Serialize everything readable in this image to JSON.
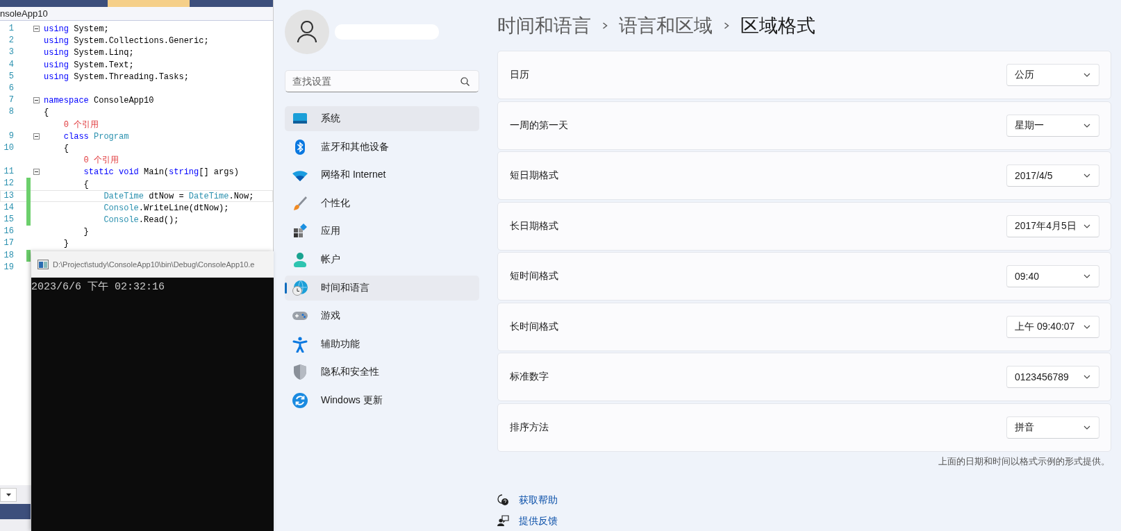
{
  "editor": {
    "title": "nsoleApp10",
    "lines": [
      {
        "kind": "code",
        "number": "1",
        "fold": true,
        "changed": false,
        "current": false,
        "tokens": [
          {
            "kind": "keyword",
            "text": "using"
          },
          {
            "kind": "plain",
            "text": " System;"
          }
        ]
      },
      {
        "kind": "code",
        "number": "2",
        "fold": false,
        "changed": false,
        "current": false,
        "tokens": [
          {
            "kind": "keyword",
            "text": "using"
          },
          {
            "kind": "plain",
            "text": " System.Collections.Generic;"
          }
        ]
      },
      {
        "kind": "code",
        "number": "3",
        "fold": false,
        "changed": false,
        "current": false,
        "tokens": [
          {
            "kind": "keyword",
            "text": "using"
          },
          {
            "kind": "plain",
            "text": " System.Linq;"
          }
        ]
      },
      {
        "kind": "code",
        "number": "4",
        "fold": false,
        "changed": false,
        "current": false,
        "tokens": [
          {
            "kind": "keyword",
            "text": "using"
          },
          {
            "kind": "plain",
            "text": " System.Text;"
          }
        ]
      },
      {
        "kind": "code",
        "number": "5",
        "fold": false,
        "changed": false,
        "current": false,
        "tokens": [
          {
            "kind": "keyword",
            "text": "using"
          },
          {
            "kind": "plain",
            "text": " System.Threading.Tasks;"
          }
        ]
      },
      {
        "kind": "code",
        "number": "6",
        "fold": false,
        "changed": false,
        "current": false
      },
      {
        "kind": "code",
        "number": "7",
        "fold": true,
        "changed": false,
        "current": false,
        "tokens": [
          {
            "kind": "keyword",
            "text": "namespace"
          },
          {
            "kind": "plain",
            "text": " ConsoleApp10"
          }
        ]
      },
      {
        "kind": "code",
        "number": "8",
        "fold": false,
        "changed": false,
        "current": false,
        "tokens": [
          {
            "kind": "plain",
            "text": "{"
          }
        ]
      },
      {
        "kind": "codelens",
        "text": "    0 个引用"
      },
      {
        "kind": "code",
        "number": "9",
        "fold": true,
        "changed": false,
        "current": false,
        "tokens": [
          {
            "kind": "keyword",
            "text": "    class"
          },
          {
            "kind": "type",
            "text": " Program"
          }
        ]
      },
      {
        "kind": "code",
        "number": "10",
        "fold": false,
        "changed": false,
        "current": false,
        "tokens": [
          {
            "kind": "plain",
            "text": "    {"
          }
        ]
      },
      {
        "kind": "codelens",
        "text": "        0 个引用"
      },
      {
        "kind": "code",
        "number": "11",
        "fold": true,
        "changed": false,
        "current": false,
        "tokens": [
          {
            "kind": "keyword",
            "text": "        static void"
          },
          {
            "kind": "plain",
            "text": " Main("
          },
          {
            "kind": "keyword",
            "text": "string"
          },
          {
            "kind": "plain",
            "text": "[] args)"
          }
        ]
      },
      {
        "kind": "code",
        "number": "12",
        "fold": false,
        "changed": true,
        "current": false,
        "tokens": [
          {
            "kind": "plain",
            "text": "        {"
          }
        ]
      },
      {
        "kind": "code",
        "number": "13",
        "fold": false,
        "changed": true,
        "current": true,
        "tokens": [
          {
            "kind": "type",
            "text": "            DateTime"
          },
          {
            "kind": "plain",
            "text": " dtNow = "
          },
          {
            "kind": "type",
            "text": "DateTime"
          },
          {
            "kind": "plain",
            "text": ".Now;"
          }
        ]
      },
      {
        "kind": "code",
        "number": "14",
        "fold": false,
        "changed": true,
        "current": false,
        "tokens": [
          {
            "kind": "type",
            "text": "            Console"
          },
          {
            "kind": "plain",
            "text": ".WriteLine(dtNow);"
          }
        ]
      },
      {
        "kind": "code",
        "number": "15",
        "fold": false,
        "changed": true,
        "current": false,
        "tokens": [
          {
            "kind": "type",
            "text": "            Console"
          },
          {
            "kind": "plain",
            "text": ".Read();"
          }
        ]
      },
      {
        "kind": "code",
        "number": "16",
        "fold": false,
        "changed": false,
        "current": false,
        "tokens": [
          {
            "kind": "plain",
            "text": "        }"
          }
        ]
      },
      {
        "kind": "code",
        "number": "17",
        "fold": false,
        "changed": false,
        "current": false,
        "tokens": [
          {
            "kind": "plain",
            "text": "    }"
          }
        ]
      },
      {
        "kind": "code",
        "number": "18",
        "fold": false,
        "changed": true,
        "current": false
      },
      {
        "kind": "code",
        "number": "19",
        "fold": false,
        "changed": false,
        "current": false
      }
    ]
  },
  "console": {
    "title": "D:\\Project\\study\\ConsoleApp10\\bin\\Debug\\ConsoleApp10.e",
    "output": "2023/6/6 下午 02:32:16"
  },
  "settings": {
    "search": {
      "placeholder": "查找设置"
    },
    "nav": [
      {
        "kind": "system",
        "label": "系统",
        "selected": false,
        "hovered": true
      },
      {
        "kind": "bluetooth",
        "label": "蓝牙和其他设备",
        "selected": false,
        "hovered": false
      },
      {
        "kind": "network",
        "label": "网络和 Internet",
        "selected": false,
        "hovered": false
      },
      {
        "kind": "personalization",
        "label": "个性化",
        "selected": false,
        "hovered": false
      },
      {
        "kind": "apps",
        "label": "应用",
        "selected": false,
        "hovered": false
      },
      {
        "kind": "accounts",
        "label": "帐户",
        "selected": false,
        "hovered": false
      },
      {
        "kind": "time",
        "label": "时间和语言",
        "selected": true,
        "hovered": false
      },
      {
        "kind": "gaming",
        "label": "游戏",
        "selected": false,
        "hovered": false
      },
      {
        "kind": "accessibility",
        "label": "辅助功能",
        "selected": false,
        "hovered": false
      },
      {
        "kind": "privacy",
        "label": "隐私和安全性",
        "selected": false,
        "hovered": false
      },
      {
        "kind": "update",
        "label": "Windows 更新",
        "selected": false,
        "hovered": false
      }
    ],
    "breadcrumb": [
      "时间和语言",
      "语言和区域",
      "区域格式"
    ],
    "rows": [
      {
        "label": "日历",
        "value": "公历"
      },
      {
        "label": "一周的第一天",
        "value": "星期一"
      },
      {
        "label": "短日期格式",
        "value": "2017/4/5"
      },
      {
        "label": "长日期格式",
        "value": "2017年4月5日"
      },
      {
        "label": "短时间格式",
        "value": "09:40"
      },
      {
        "label": "长时间格式",
        "value": "上午 09:40:07"
      },
      {
        "label": "标准数字",
        "value": "0123456789"
      },
      {
        "label": "排序方法",
        "value": "拼音"
      }
    ],
    "note": "上面的日期和时间以格式示例的形式提供。",
    "links": [
      {
        "kind": "help",
        "label": "获取帮助"
      },
      {
        "kind": "feedback",
        "label": "提供反馈"
      }
    ]
  }
}
